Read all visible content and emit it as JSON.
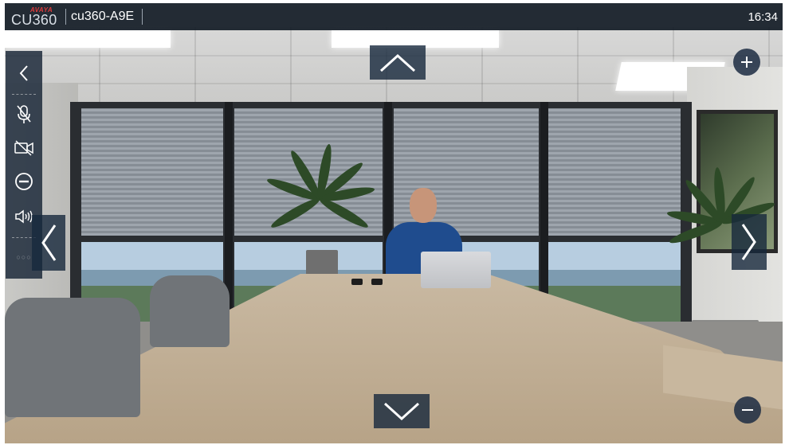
{
  "topbar": {
    "brand_small": "AVAYA",
    "brand_product": "CU360",
    "device_name": "cu360-A9E",
    "clock": "16:34"
  },
  "sidebar": {
    "items": [
      {
        "name": "back",
        "icon": "chevron-left-icon"
      },
      {
        "name": "microphone-mute",
        "icon": "microphone-muted-icon"
      },
      {
        "name": "camera-off",
        "icon": "video-off-icon"
      },
      {
        "name": "do-not-disturb",
        "icon": "minus-circle-icon"
      },
      {
        "name": "volume",
        "icon": "speaker-volume-icon"
      }
    ],
    "dots": "○○○"
  },
  "camera_controls": {
    "tilt_up_icon": "chevron-up-icon",
    "tilt_down_icon": "chevron-down-icon",
    "pan_left_icon": "chevron-left-icon",
    "pan_right_icon": "chevron-right-icon",
    "zoom_in_icon": "plus-icon",
    "zoom_out_icon": "minus-icon"
  },
  "colors": {
    "topbar_bg": "#141c26",
    "control_bg": "#16283c",
    "icon": "#ffffff",
    "brand_red": "#e23a3a"
  }
}
